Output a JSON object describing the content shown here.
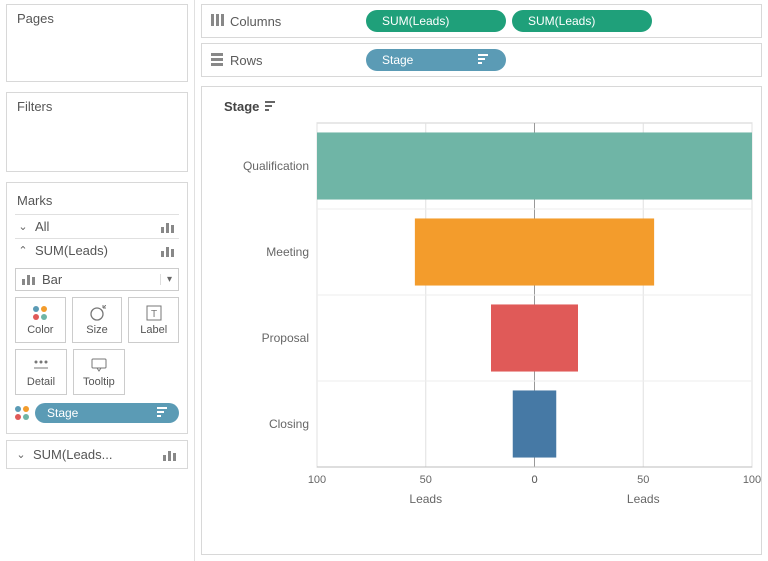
{
  "sidebar": {
    "pages_label": "Pages",
    "filters_label": "Filters",
    "marks_label": "Marks",
    "marks_rows": [
      {
        "label": "All",
        "expanded": false
      },
      {
        "label": "SUM(Leads)",
        "expanded": true
      }
    ],
    "mark_type_selected": "Bar",
    "mark_buttons_row1": [
      {
        "label": "Color"
      },
      {
        "label": "Size"
      },
      {
        "label": "Label"
      }
    ],
    "mark_buttons_row2": [
      {
        "label": "Detail"
      },
      {
        "label": "Tooltip"
      }
    ],
    "stage_pill": "Stage",
    "bottom_row_label": "SUM(Leads..."
  },
  "shelves": {
    "columns_label": "Columns",
    "columns_pills": [
      "SUM(Leads)",
      "SUM(Leads)"
    ],
    "rows_label": "Rows",
    "rows_pills": [
      "Stage"
    ]
  },
  "viz": {
    "header_label": "Stage"
  },
  "chart_data": {
    "type": "bar",
    "orientation": "horizontal",
    "categories": [
      "Qualification",
      "Meeting",
      "Proposal",
      "Closing"
    ],
    "series": [
      {
        "name": "Leads (left)",
        "values": [
          100,
          55,
          20,
          10
        ],
        "axis_direction": "reversed"
      },
      {
        "name": "Leads (right)",
        "values": [
          100,
          55,
          20,
          10
        ],
        "axis_direction": "normal"
      }
    ],
    "colors": [
      "#6fb5a6",
      "#f39c2c",
      "#e05a58",
      "#4679a5"
    ],
    "left_axis": {
      "label": "Leads",
      "range": [
        0,
        100
      ],
      "ticks": [
        100,
        50,
        0
      ]
    },
    "right_axis": {
      "label": "Leads",
      "range": [
        0,
        100
      ],
      "ticks": [
        0,
        50,
        100
      ]
    }
  }
}
